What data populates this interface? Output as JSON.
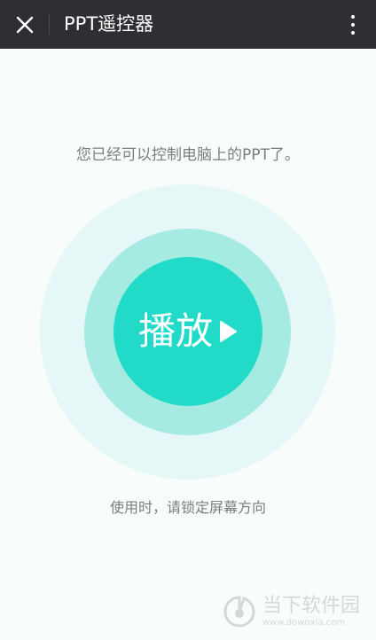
{
  "header": {
    "title": "PPT遥控器",
    "close_icon": "close-icon",
    "more_icon": "more-vertical-icon"
  },
  "main": {
    "status_text": "您已经可以控制电脑上的PPT了。",
    "play_button_label": "播放",
    "play_icon": "play-icon",
    "orientation_hint": "使用时，请锁定屏幕方向"
  },
  "watermark": {
    "name_cn": "当下软件园",
    "domain": "www.downxia.com"
  },
  "colors": {
    "header_bg": "#2e2f33",
    "page_bg": "#f8fcfb",
    "accent": "#21dbc8",
    "ring_middle": "#a6ebe2",
    "ring_outer": "#e6f7f7",
    "secondary_text": "#7b7e80"
  }
}
